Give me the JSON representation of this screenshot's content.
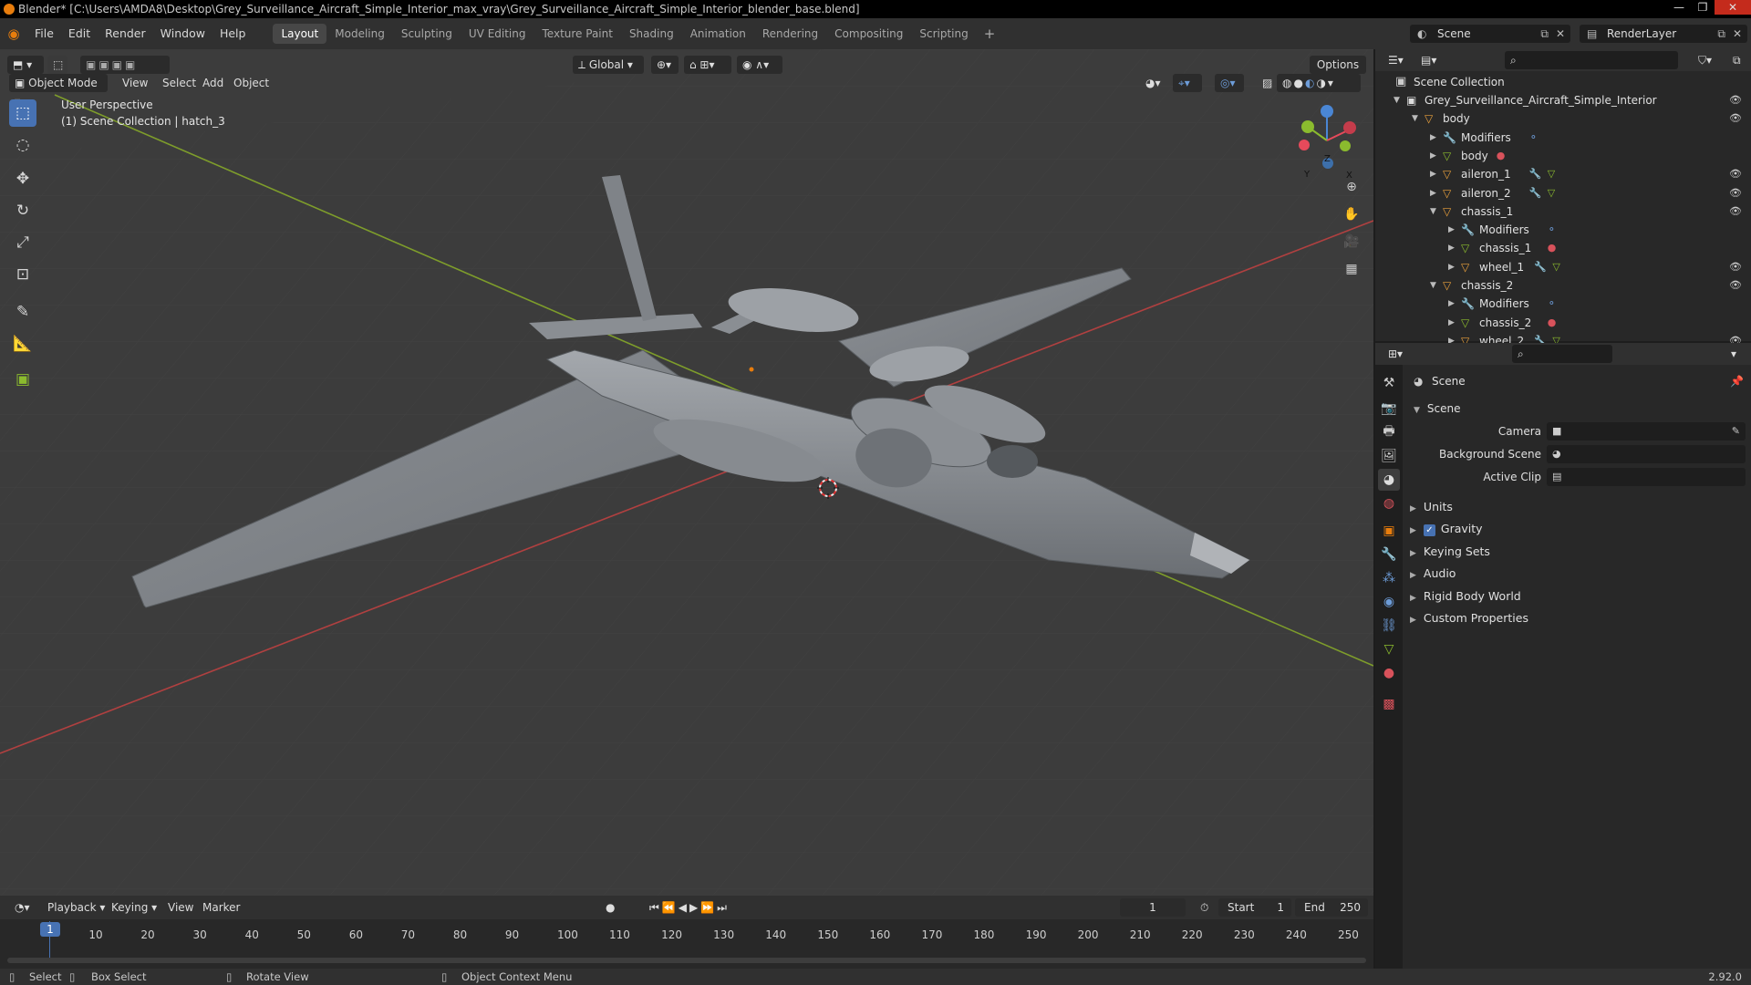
{
  "window": {
    "title": "Blender* [C:\\Users\\AMDA8\\Desktop\\Grey_Surveillance_Aircraft_Simple_Interior_max_vray\\Grey_Surveillance_Aircraft_Simple_Interior_blender_base.blend]"
  },
  "menu": [
    "File",
    "Edit",
    "Render",
    "Window",
    "Help"
  ],
  "workspaces": [
    {
      "label": "Layout",
      "active": true
    },
    {
      "label": "Modeling"
    },
    {
      "label": "Sculpting"
    },
    {
      "label": "UV Editing"
    },
    {
      "label": "Texture Paint"
    },
    {
      "label": "Shading"
    },
    {
      "label": "Animation"
    },
    {
      "label": "Rendering"
    },
    {
      "label": "Compositing"
    },
    {
      "label": "Scripting"
    }
  ],
  "topright": {
    "scene": "Scene",
    "render_layer": "RenderLayer"
  },
  "viewport": {
    "mode": "Object Mode",
    "menus": [
      "View",
      "Select",
      "Add",
      "Object"
    ],
    "transform_orientation": "Global",
    "options": "Options",
    "perspective": "User Perspective",
    "collection_info": "(1) Scene Collection | hatch_3",
    "gizmo": {
      "x": "X",
      "y": "Y",
      "z": "Z"
    }
  },
  "colors": {
    "accent": "#4772b3",
    "orange": "#e87d0d",
    "x_axis": "#e64a5b",
    "y_axis": "#8bbb2e",
    "z_axis": "#4a86d4",
    "mesh": "#e9a03c",
    "modifier": "#6d9cd8",
    "material": "#d8525b"
  },
  "timeline": {
    "menus": [
      "Playback",
      "Keying",
      "View",
      "Marker"
    ],
    "current_frame": "1",
    "start_label": "Start",
    "start": "1",
    "end_label": "End",
    "end": "250",
    "ticks": [
      "10",
      "20",
      "30",
      "40",
      "50",
      "60",
      "70",
      "80",
      "90",
      "100",
      "110",
      "120",
      "130",
      "140",
      "150",
      "160",
      "170",
      "180",
      "190",
      "200",
      "210",
      "220",
      "230",
      "240",
      "250"
    ]
  },
  "statusbar": {
    "select": "Select",
    "box_select": "Box Select",
    "rotate": "Rotate View",
    "context": "Object Context Menu",
    "version": "2.92.0"
  },
  "outliner": {
    "root": "Scene Collection",
    "rows": [
      {
        "label": "Grey_Surveillance_Aircraft_Simple_Interior",
        "depth": 0,
        "icon": "collection-icon",
        "expanded": true,
        "eye": true
      },
      {
        "label": "body",
        "depth": 1,
        "icon": "object-icon",
        "expanded": true,
        "eye": true
      },
      {
        "label": "Modifiers",
        "depth": 2,
        "icon": "wrench-icon",
        "extras": [
          "modifier-icon"
        ],
        "eye": false
      },
      {
        "label": "body",
        "depth": 2,
        "icon": "mesh-icon",
        "extras": [
          "material-icon"
        ],
        "eye": false
      },
      {
        "label": "aileron_1",
        "depth": 2,
        "icon": "object-icon",
        "extras": [
          "wrench-icon",
          "mesh-icon"
        ],
        "eye": true
      },
      {
        "label": "aileron_2",
        "depth": 2,
        "icon": "object-icon",
        "extras": [
          "wrench-icon",
          "mesh-icon"
        ],
        "eye": true
      },
      {
        "label": "chassis_1",
        "depth": 2,
        "icon": "object-icon",
        "expanded": true,
        "eye": true
      },
      {
        "label": "Modifiers",
        "depth": 3,
        "icon": "wrench-icon",
        "extras": [
          "modifier-icon"
        ],
        "eye": false
      },
      {
        "label": "chassis_1",
        "depth": 3,
        "icon": "mesh-icon",
        "extras": [
          "material-icon"
        ],
        "eye": false
      },
      {
        "label": "wheel_1",
        "depth": 3,
        "icon": "object-icon",
        "extras": [
          "wrench-icon",
          "mesh-icon"
        ],
        "eye": true
      },
      {
        "label": "chassis_2",
        "depth": 2,
        "icon": "object-icon",
        "expanded": true,
        "eye": true
      },
      {
        "label": "Modifiers",
        "depth": 3,
        "icon": "wrench-icon",
        "extras": [
          "modifier-icon"
        ],
        "eye": false
      },
      {
        "label": "chassis_2",
        "depth": 3,
        "icon": "mesh-icon",
        "extras": [
          "material-icon"
        ],
        "eye": false
      },
      {
        "label": "wheel_2",
        "depth": 3,
        "icon": "object-icon",
        "extras": [
          "wrench-icon",
          "mesh-icon"
        ],
        "eye": true
      }
    ]
  },
  "properties": {
    "breadcrumb": "Scene",
    "panel": "Scene",
    "camera_label": "Camera",
    "bg_scene_label": "Background Scene",
    "active_clip_label": "Active Clip",
    "sections": [
      {
        "label": "Units"
      },
      {
        "label": "Gravity",
        "checkbox": true
      },
      {
        "label": "Keying Sets"
      },
      {
        "label": "Audio"
      },
      {
        "label": "Rigid Body World"
      },
      {
        "label": "Custom Properties"
      }
    ]
  }
}
